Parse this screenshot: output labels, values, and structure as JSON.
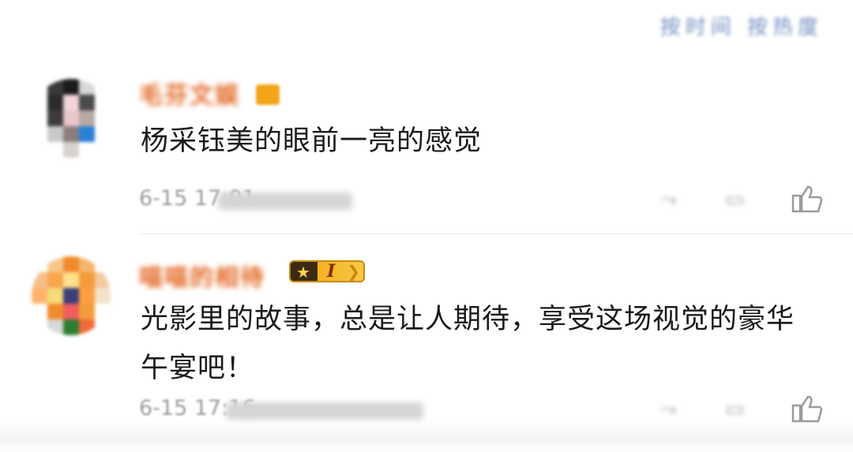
{
  "header": {
    "sort_label": "按时间 按热度"
  },
  "comments": [
    {
      "username": "毛芬文娱",
      "text": "杨采钰美的眼前一亮的感觉",
      "time": "6-15 17:01",
      "location": "来自河南",
      "avatar_colors": [
        "#ffffff",
        "#3a3a3a",
        "#1b1b1b",
        "#d8d8d8",
        "#ffffff",
        "#ffffff",
        "#2b2b2b",
        "#f1d5d8",
        "#4a4a4a",
        "#ffffff",
        "#ffffff",
        "#3c3c3c",
        "#e8c7ca",
        "#b8a9a6",
        "#ffffff",
        "#ffffff",
        "#c9c9c9",
        "#8a7f7c",
        "#2a7fd6",
        "#ffffff",
        "#ffffff",
        "#ffffff",
        "#d7d2cf",
        "#ffffff",
        "#ffffff"
      ]
    },
    {
      "username": "喵喵的相待",
      "badge_level": "I",
      "text": "光影里的故事，总是让人期待，享受这场视觉的豪华午宴吧！",
      "time": "6-15 17:16",
      "location": "来自陕西",
      "avatar_colors": [
        "#ffffff",
        "#f6c78a",
        "#f08a2a",
        "#f6b56d",
        "#ffffff",
        "#f3c08a",
        "#f7a64c",
        "#ffe08c",
        "#f29d3a",
        "#f5caa0",
        "#ffb36a",
        "#f6dc7a",
        "#3a3f7a",
        "#ff9f3f",
        "#f3e2c8",
        "#ffffff",
        "#f08a2a",
        "#f05d5d",
        "#f29d3a",
        "#ffffff",
        "#ffffff",
        "#d9d9d9",
        "#2f7d32",
        "#f06a3a",
        "#ffffff"
      ]
    }
  ],
  "actions": {
    "share_icon": "share-icon",
    "comment_icon": "comment-icon",
    "like_icon": "like-icon"
  }
}
